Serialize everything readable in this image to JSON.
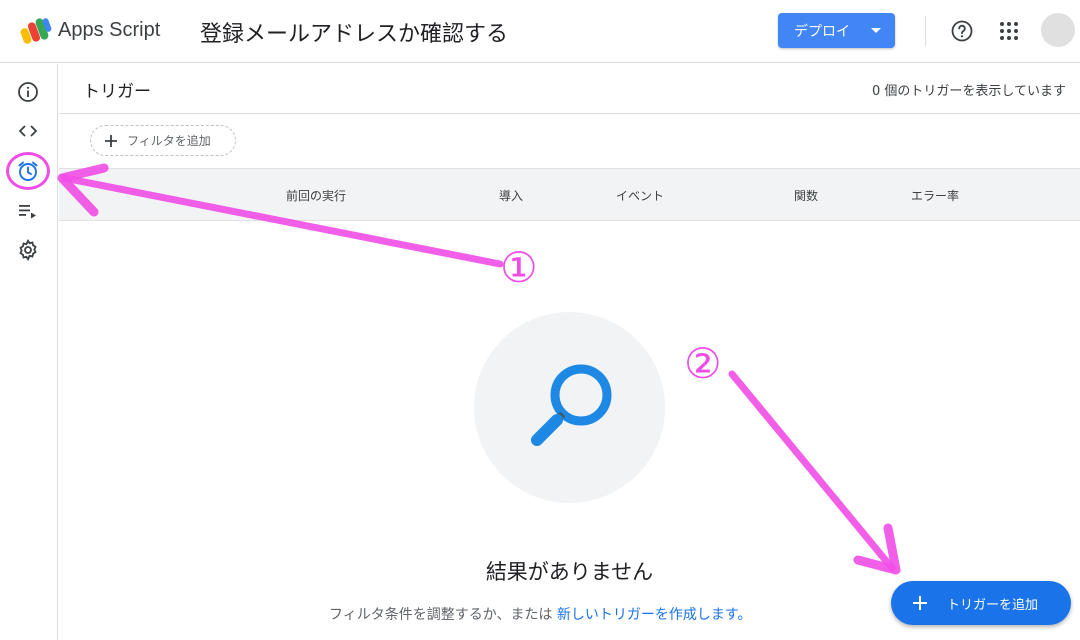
{
  "header": {
    "app_name": "Apps Script",
    "project_title": "登録メールアドレスか確認する",
    "deploy_label": "デプロイ"
  },
  "sidebar": {
    "items": [
      {
        "icon": "info-icon"
      },
      {
        "icon": "code-icon"
      },
      {
        "icon": "alarm-clock-icon",
        "active": true
      },
      {
        "icon": "playlist-run-icon"
      },
      {
        "icon": "gear-icon"
      }
    ]
  },
  "main": {
    "title": "トリガー",
    "count_text": "0 個のトリガーを表示しています",
    "filter_label": "フィルタを追加",
    "columns": [
      "前回の実行",
      "導入",
      "イベント",
      "関数",
      "エラー率"
    ],
    "empty_title": "結果がありません",
    "empty_desc_prefix": "フィルタ条件を調整するか、または",
    "empty_desc_link": "新しいトリガーを作成します。",
    "fab_label": "トリガーを追加"
  },
  "annotations": {
    "label_1": "①",
    "label_2": "②",
    "color": "#f04de6"
  },
  "colors": {
    "primary": "#1a73e8",
    "deploy": "#4285f4",
    "magnifier": "#1e88e5"
  }
}
